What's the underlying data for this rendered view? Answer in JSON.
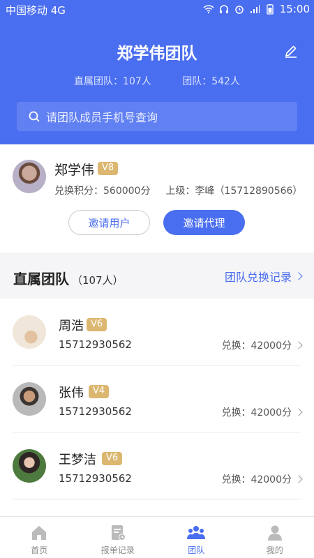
{
  "status_bar": {
    "carrier": "中国移动 4G",
    "time": "15:00"
  },
  "header": {
    "title": "郑学伟团队",
    "direct_team": "直属团队：107人",
    "team": "团队：542人",
    "search_placeholder": "请团队成员手机号查询"
  },
  "profile": {
    "name": "郑学伟",
    "level": "V8",
    "points": "兑换积分：560000分",
    "superior": "上级：李峰（15712890566）",
    "invite_user": "邀请用户",
    "invite_agent": "邀请代理"
  },
  "section": {
    "title": "直属团队",
    "count": "（107人）",
    "records_link": "团队兑换记录"
  },
  "members": [
    {
      "name": "周浩",
      "level": "V6",
      "phone": "15712930562",
      "exchange": "兑换：42000分"
    },
    {
      "name": "张伟",
      "level": "V4",
      "phone": "15712930562",
      "exchange": "兑换：42000分"
    },
    {
      "name": "王梦洁",
      "level": "V6",
      "phone": "15712930562",
      "exchange": "兑换：42000分"
    }
  ],
  "tabbar": {
    "home": "首页",
    "orders": "报单记录",
    "team": "团队",
    "mine": "我的"
  },
  "colors": {
    "primary": "#4a6ef0",
    "badge": "#dcb770"
  }
}
